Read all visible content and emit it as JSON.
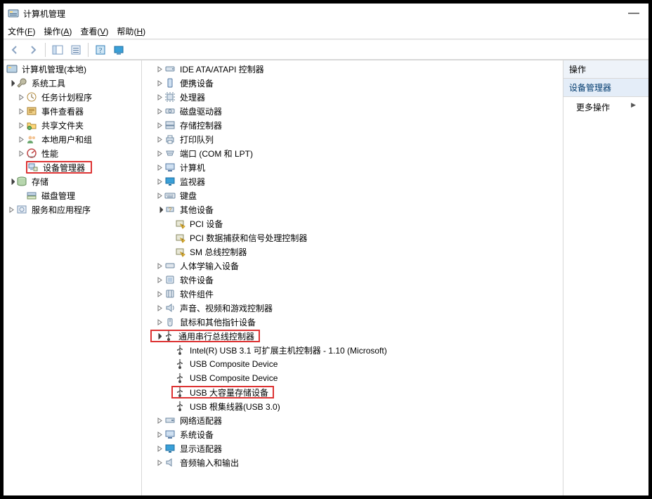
{
  "window": {
    "title": "计算机管理",
    "min_label": "—"
  },
  "menu": {
    "file": "文件",
    "file_k": "F",
    "action": "操作",
    "action_k": "A",
    "view": "查看",
    "view_k": "V",
    "help": "帮助",
    "help_k": "H"
  },
  "left_tree": {
    "root": "计算机管理(本地)",
    "system_tools": "系统工具",
    "task_scheduler": "任务计划程序",
    "event_viewer": "事件查看器",
    "shared_folders": "共享文件夹",
    "local_users": "本地用户和组",
    "performance": "性能",
    "device_manager": "设备管理器",
    "storage": "存储",
    "disk_mgmt": "磁盘管理",
    "services_apps": "服务和应用程序"
  },
  "mid_tree": {
    "ide": "IDE ATA/ATAPI 控制器",
    "portable": "便携设备",
    "cpu": "处理器",
    "disk_drives": "磁盘驱动器",
    "storage_ctrl": "存储控制器",
    "print": "打印队列",
    "ports": "端口 (COM 和 LPT)",
    "computer": "计算机",
    "monitors": "监视器",
    "keyboards": "键盘",
    "other": "其他设备",
    "other_pci": "PCI 设备",
    "other_pci_sig": "PCI 数据捕获和信号处理控制器",
    "other_sm": "SM 总线控制器",
    "hid": "人体学输入设备",
    "soft_dev": "软件设备",
    "soft_comp": "软件组件",
    "audio_game": "声音、视频和游戏控制器",
    "mice": "鼠标和其他指针设备",
    "usb_ctrl": "通用串行总线控制器",
    "usb_intel": "Intel(R) USB 3.1 可扩展主机控制器 - 1.10 (Microsoft)",
    "usb_comp1": "USB Composite Device",
    "usb_comp2": "USB Composite Device",
    "usb_mass": "USB 大容量存储设备",
    "usb_root": "USB 根集线器(USB 3.0)",
    "network": "网络适配器",
    "system_dev": "系统设备",
    "display": "显示适配器",
    "audio_io": "音频输入和输出"
  },
  "right": {
    "header": "操作",
    "selection": "设备管理器",
    "more_actions": "更多操作"
  }
}
